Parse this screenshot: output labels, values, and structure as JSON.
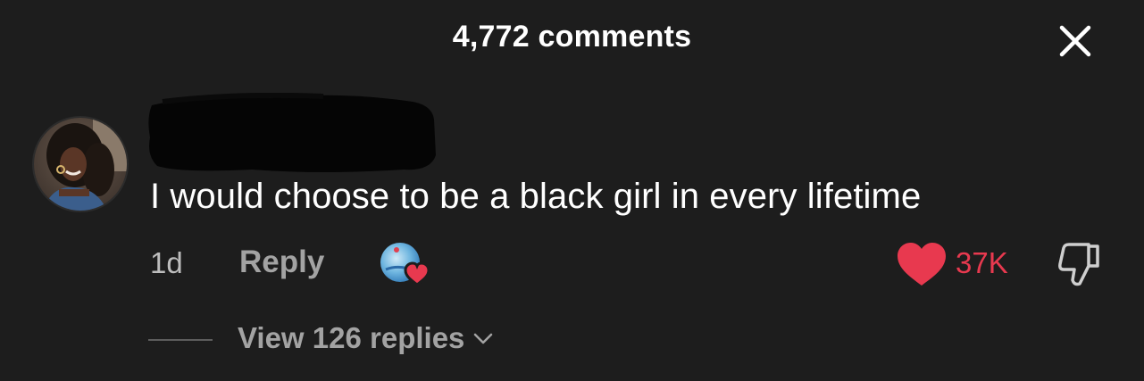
{
  "header": {
    "title": "4,772 comments"
  },
  "icons": {
    "close": "close-icon",
    "like": "heart-icon",
    "dislike": "thumbs-down-icon",
    "creator_like": "creator-liked-heart-icon",
    "chevron": "chevron-down-icon"
  },
  "comment": {
    "username": "",
    "text": "I would choose to be a black girl in every lifetime",
    "time": "1d",
    "reply_label": "Reply",
    "like_count": "37K",
    "liked": true,
    "view_replies_label": "View 126 replies"
  },
  "colors": {
    "background": "#1d1d1d",
    "like_red": "#e8394f",
    "secondary_text": "#a3a3a3"
  }
}
